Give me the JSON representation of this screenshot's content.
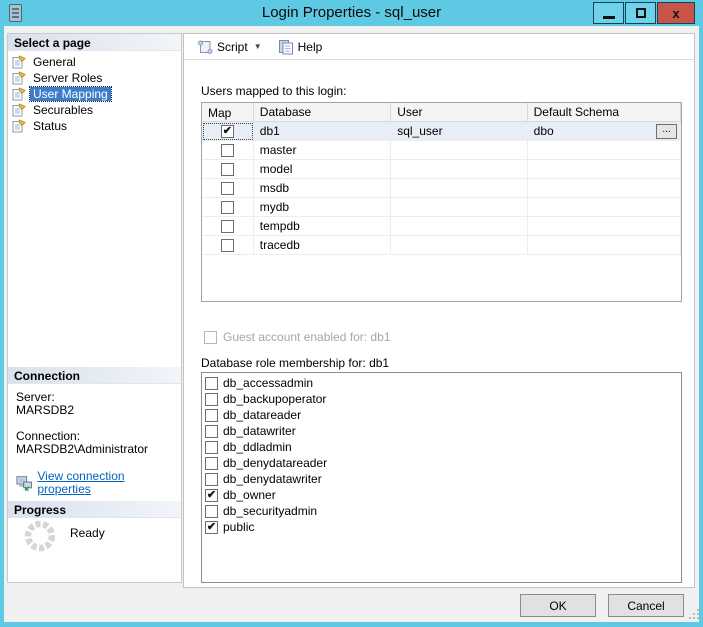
{
  "colors": {
    "titlebar": "#5ec9e2",
    "close_button": "#c9544a",
    "selection_blue": "#3d7cc9",
    "selected_row": "#e7eef6",
    "link_blue": "#0563c1",
    "section_header_gradient": "#d9e1ec"
  },
  "window": {
    "title": "Login Properties - sql_user",
    "close_glyph": "x",
    "icons": [
      "form-icon",
      "minimize-icon",
      "maximize-icon",
      "close-icon"
    ]
  },
  "toolbar": {
    "script_label": "Script",
    "dropdown_glyph": "▼",
    "help_label": "Help"
  },
  "sidebar": {
    "select_page_header": "Select a page",
    "pages": [
      {
        "label": "General",
        "selected": false
      },
      {
        "label": "Server Roles",
        "selected": false
      },
      {
        "label": "User Mapping",
        "selected": true
      },
      {
        "label": "Securables",
        "selected": false
      },
      {
        "label": "Status",
        "selected": false
      }
    ],
    "connection_header": "Connection",
    "server_label": "Server:",
    "server_value": "MARSDB2",
    "connection_label": "Connection:",
    "connection_value": "MARSDB2\\Administrator",
    "link_label": "View connection properties",
    "progress_header": "Progress",
    "progress_status": "Ready"
  },
  "main": {
    "users_label": "Users mapped to this login:",
    "columns": [
      "Map",
      "Database",
      "User",
      "Default Schema"
    ],
    "rows": [
      {
        "mark": "✔",
        "database": "db1",
        "user": "sql_user",
        "schema": "dbo",
        "browse": "...",
        "selected": true
      },
      {
        "mark": "",
        "database": "master",
        "user": "",
        "schema": ""
      },
      {
        "mark": "",
        "database": "model",
        "user": "",
        "schema": ""
      },
      {
        "mark": "",
        "database": "msdb",
        "user": "",
        "schema": ""
      },
      {
        "mark": "",
        "database": "mydb",
        "user": "",
        "schema": ""
      },
      {
        "mark": "",
        "database": "tempdb",
        "user": "",
        "schema": ""
      },
      {
        "mark": "",
        "database": "tracedb",
        "user": "",
        "schema": ""
      }
    ],
    "guest_label": "Guest account enabled for: db1",
    "guest_mark": "",
    "roles_label": "Database role membership for: db1",
    "roles": [
      {
        "mark": "",
        "label": "db_accessadmin"
      },
      {
        "mark": "",
        "label": "db_backupoperator"
      },
      {
        "mark": "",
        "label": "db_datareader"
      },
      {
        "mark": "",
        "label": "db_datawriter"
      },
      {
        "mark": "",
        "label": "db_ddladmin"
      },
      {
        "mark": "",
        "label": "db_denydatareader"
      },
      {
        "mark": "",
        "label": "db_denydatawriter"
      },
      {
        "mark": "✔",
        "label": "db_owner"
      },
      {
        "mark": "",
        "label": "db_securityadmin"
      },
      {
        "mark": "✔",
        "label": "public"
      }
    ]
  },
  "footer": {
    "ok_label": "OK",
    "cancel_label": "Cancel"
  }
}
